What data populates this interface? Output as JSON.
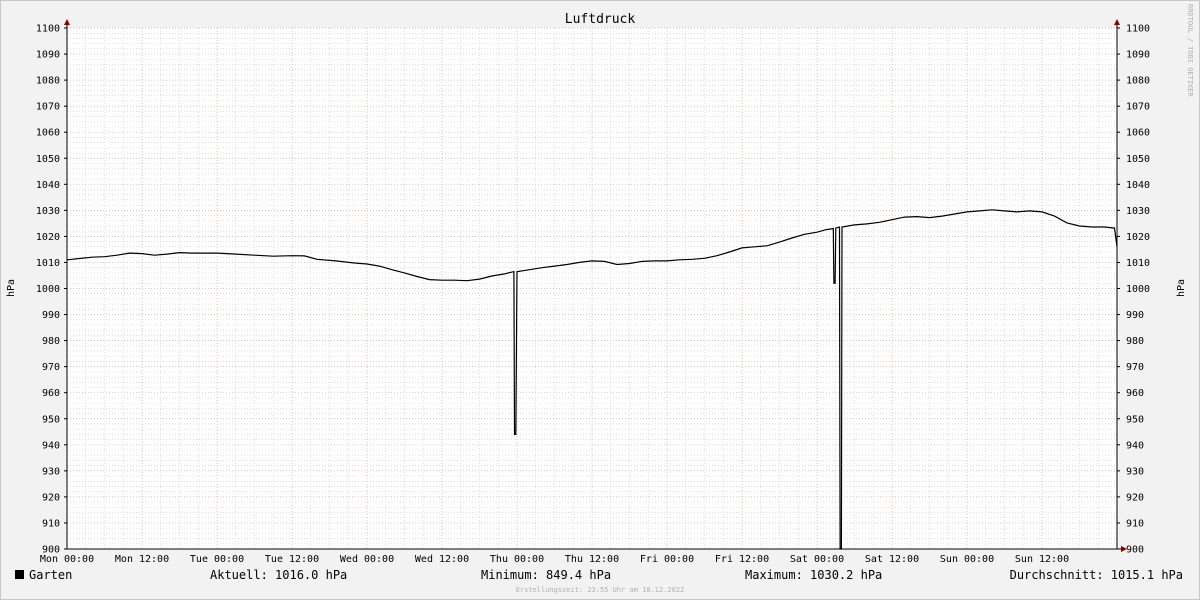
{
  "chart_data": {
    "type": "line",
    "title": "Luftdruck",
    "ylabel": "hPa",
    "ylim": [
      900,
      1100
    ],
    "y_ticks": [
      900,
      910,
      920,
      930,
      940,
      950,
      960,
      970,
      980,
      990,
      1000,
      1010,
      1020,
      1030,
      1040,
      1050,
      1060,
      1070,
      1080,
      1090,
      1100
    ],
    "x_ticks": [
      "Mon 00:00",
      "Mon 12:00",
      "Tue 00:00",
      "Tue 12:00",
      "Wed 00:00",
      "Wed 12:00",
      "Thu 00:00",
      "Thu 12:00",
      "Fri 00:00",
      "Fri 12:00",
      "Sat 00:00",
      "Sat 12:00",
      "Sun 00:00",
      "Sun 12:00"
    ],
    "x_unit": "hours since Mon 00:00",
    "xlim": [
      0,
      168
    ],
    "grid": true,
    "series": [
      {
        "name": "Garten",
        "color": "#000000",
        "points": [
          [
            0,
            1011
          ],
          [
            2,
            1011.5
          ],
          [
            4,
            1012
          ],
          [
            6,
            1012.2
          ],
          [
            8,
            1012.8
          ],
          [
            10,
            1013.6
          ],
          [
            12,
            1013.4
          ],
          [
            14,
            1012.8
          ],
          [
            16,
            1013.2
          ],
          [
            18,
            1013.8
          ],
          [
            20,
            1013.6
          ],
          [
            24,
            1013.6
          ],
          [
            27,
            1013.2
          ],
          [
            30,
            1012.8
          ],
          [
            33,
            1012.4
          ],
          [
            36,
            1012.6
          ],
          [
            38,
            1012.5
          ],
          [
            40,
            1011.2
          ],
          [
            43,
            1010.6
          ],
          [
            46,
            1009.8
          ],
          [
            48,
            1009.4
          ],
          [
            50,
            1008.6
          ],
          [
            52,
            1007.2
          ],
          [
            54,
            1006
          ],
          [
            56,
            1004.6
          ],
          [
            58,
            1003.4
          ],
          [
            60,
            1003.2
          ],
          [
            62,
            1003.2
          ],
          [
            64,
            1003
          ],
          [
            66,
            1003.6
          ],
          [
            68,
            1004.8
          ],
          [
            70,
            1005.6
          ],
          [
            71.5,
            1006.5
          ],
          [
            71.6,
            944
          ],
          [
            71.8,
            944
          ],
          [
            72,
            1006.5
          ],
          [
            74,
            1007.2
          ],
          [
            76,
            1008
          ],
          [
            78,
            1008.6
          ],
          [
            80,
            1009.2
          ],
          [
            82,
            1010
          ],
          [
            84,
            1010.6
          ],
          [
            86,
            1010.4
          ],
          [
            88,
            1009.2
          ],
          [
            90,
            1009.6
          ],
          [
            92,
            1010.4
          ],
          [
            94,
            1010.6
          ],
          [
            96,
            1010.6
          ],
          [
            98,
            1011
          ],
          [
            100,
            1011.2
          ],
          [
            102,
            1011.6
          ],
          [
            104,
            1012.6
          ],
          [
            106,
            1014
          ],
          [
            108,
            1015.6
          ],
          [
            110,
            1016
          ],
          [
            112,
            1016.4
          ],
          [
            114,
            1017.8
          ],
          [
            116,
            1019.4
          ],
          [
            118,
            1020.8
          ],
          [
            120,
            1021.6
          ],
          [
            121.5,
            1022.6
          ],
          [
            122.6,
            1023
          ],
          [
            122.7,
            1002
          ],
          [
            122.9,
            1002
          ],
          [
            123,
            1023.2
          ],
          [
            123.6,
            1023.6
          ],
          [
            123.7,
            849.4
          ],
          [
            123.9,
            849.4
          ],
          [
            124,
            1023.6
          ],
          [
            126,
            1024.4
          ],
          [
            128,
            1024.8
          ],
          [
            130,
            1025.4
          ],
          [
            132,
            1026.4
          ],
          [
            134,
            1027.4
          ],
          [
            136,
            1027.6
          ],
          [
            138,
            1027.2
          ],
          [
            140,
            1027.8
          ],
          [
            142,
            1028.6
          ],
          [
            144,
            1029.4
          ],
          [
            146,
            1029.8
          ],
          [
            148,
            1030.2
          ],
          [
            150,
            1029.8
          ],
          [
            152,
            1029.4
          ],
          [
            154,
            1029.8
          ],
          [
            156,
            1029.4
          ],
          [
            158,
            1027.8
          ],
          [
            160,
            1025.2
          ],
          [
            162,
            1024
          ],
          [
            164,
            1023.6
          ],
          [
            166,
            1023.6
          ],
          [
            167.6,
            1023.2
          ],
          [
            168,
            1016
          ]
        ]
      }
    ]
  },
  "legend": {
    "series_name": "Garten",
    "aktuell": "Aktuell: 1016.0 hPa",
    "minimum": "Minimum: 849.4 hPa",
    "maximum": "Maximum: 1030.2 hPa",
    "durchschnitt": "Durchschnitt: 1015.1 hPa"
  },
  "watermark": "RRDTOOL / TOBI OETIKER",
  "footer": "Erstellungszeit: 23:55 Uhr am 18.12.2022",
  "colors": {
    "background": "#f2f2f2",
    "plot_background": "#ffffff",
    "grid_minor": "#cccccc",
    "grid_major": "#e8a0a0",
    "axis_arrow": "#8b0000",
    "line": "#000000"
  }
}
